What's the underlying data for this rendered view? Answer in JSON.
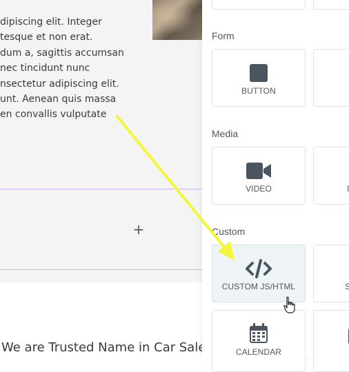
{
  "canvas": {
    "paragraph_lines": [
      "dipiscing elit. Integer",
      "tesque et non erat.",
      "dum a, sagittis accumsan",
      "nec tincidunt nunc",
      "nsectetur adipiscing elit.",
      "unt. Aenean quis massa",
      "en convallis vulputate"
    ],
    "add_symbol": "+",
    "heading": "We are Trusted Name in Car Sale"
  },
  "panel": {
    "categories": [
      {
        "title": "Form",
        "widgets": [
          {
            "label": "BUTTON",
            "icon": "button-icon"
          }
        ]
      },
      {
        "title": "Media",
        "widgets": [
          {
            "label": "VIDEO",
            "icon": "video-icon"
          }
        ]
      },
      {
        "title": "Custom",
        "widgets": [
          {
            "label": "CUSTOM JS/HTML",
            "icon": "code-icon"
          },
          {
            "label": "CALENDAR",
            "icon": "calendar-icon"
          }
        ]
      }
    ],
    "partial_labels": {
      "media_right": "I",
      "custom_right": "S"
    }
  },
  "colors": {
    "section_border": "#c8b7f2",
    "icon": "#4a5560",
    "arrow": "#f5f53a",
    "hover_bg": "#eef3f6"
  }
}
